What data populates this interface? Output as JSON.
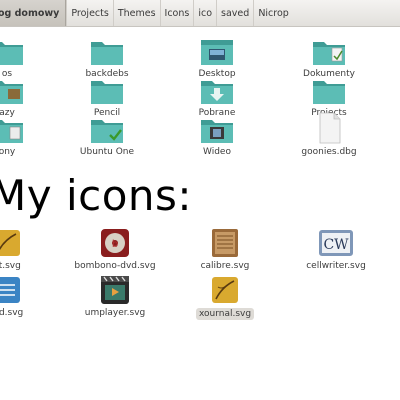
{
  "breadcrumb": {
    "items": [
      "Katalog domowy",
      "Projects",
      "Themes",
      "Icons",
      "ico",
      "saved",
      "Nicrop"
    ],
    "active_visible": "og domowy"
  },
  "folders": {
    "row1": [
      "Dokumenty",
      "backdebs",
      "Desktop",
      "Dokumenty"
    ],
    "row1_partial_first": "os",
    "row2_partial_first": "azy",
    "row2": [
      "Pencil",
      "Pobrane",
      "Projects"
    ],
    "row3_partial_first": "ony",
    "row3": [
      "Ubuntu One",
      "Wideo",
      "goonies.dbg"
    ]
  },
  "heading": "My icons:",
  "svg_icons": {
    "row1_partial_first": "et.svg",
    "row1": [
      "bombono-dvd.svg",
      "calibre.svg",
      "cellwriter.svg"
    ],
    "row2_partial_first": "ind.svg",
    "row2": [
      "umplayer.svg",
      "xournal.svg"
    ]
  },
  "colors": {
    "folder_teal": "#5cbdb5",
    "folder_teal_dark": "#3f9c95",
    "selection": "#dedbd6"
  }
}
